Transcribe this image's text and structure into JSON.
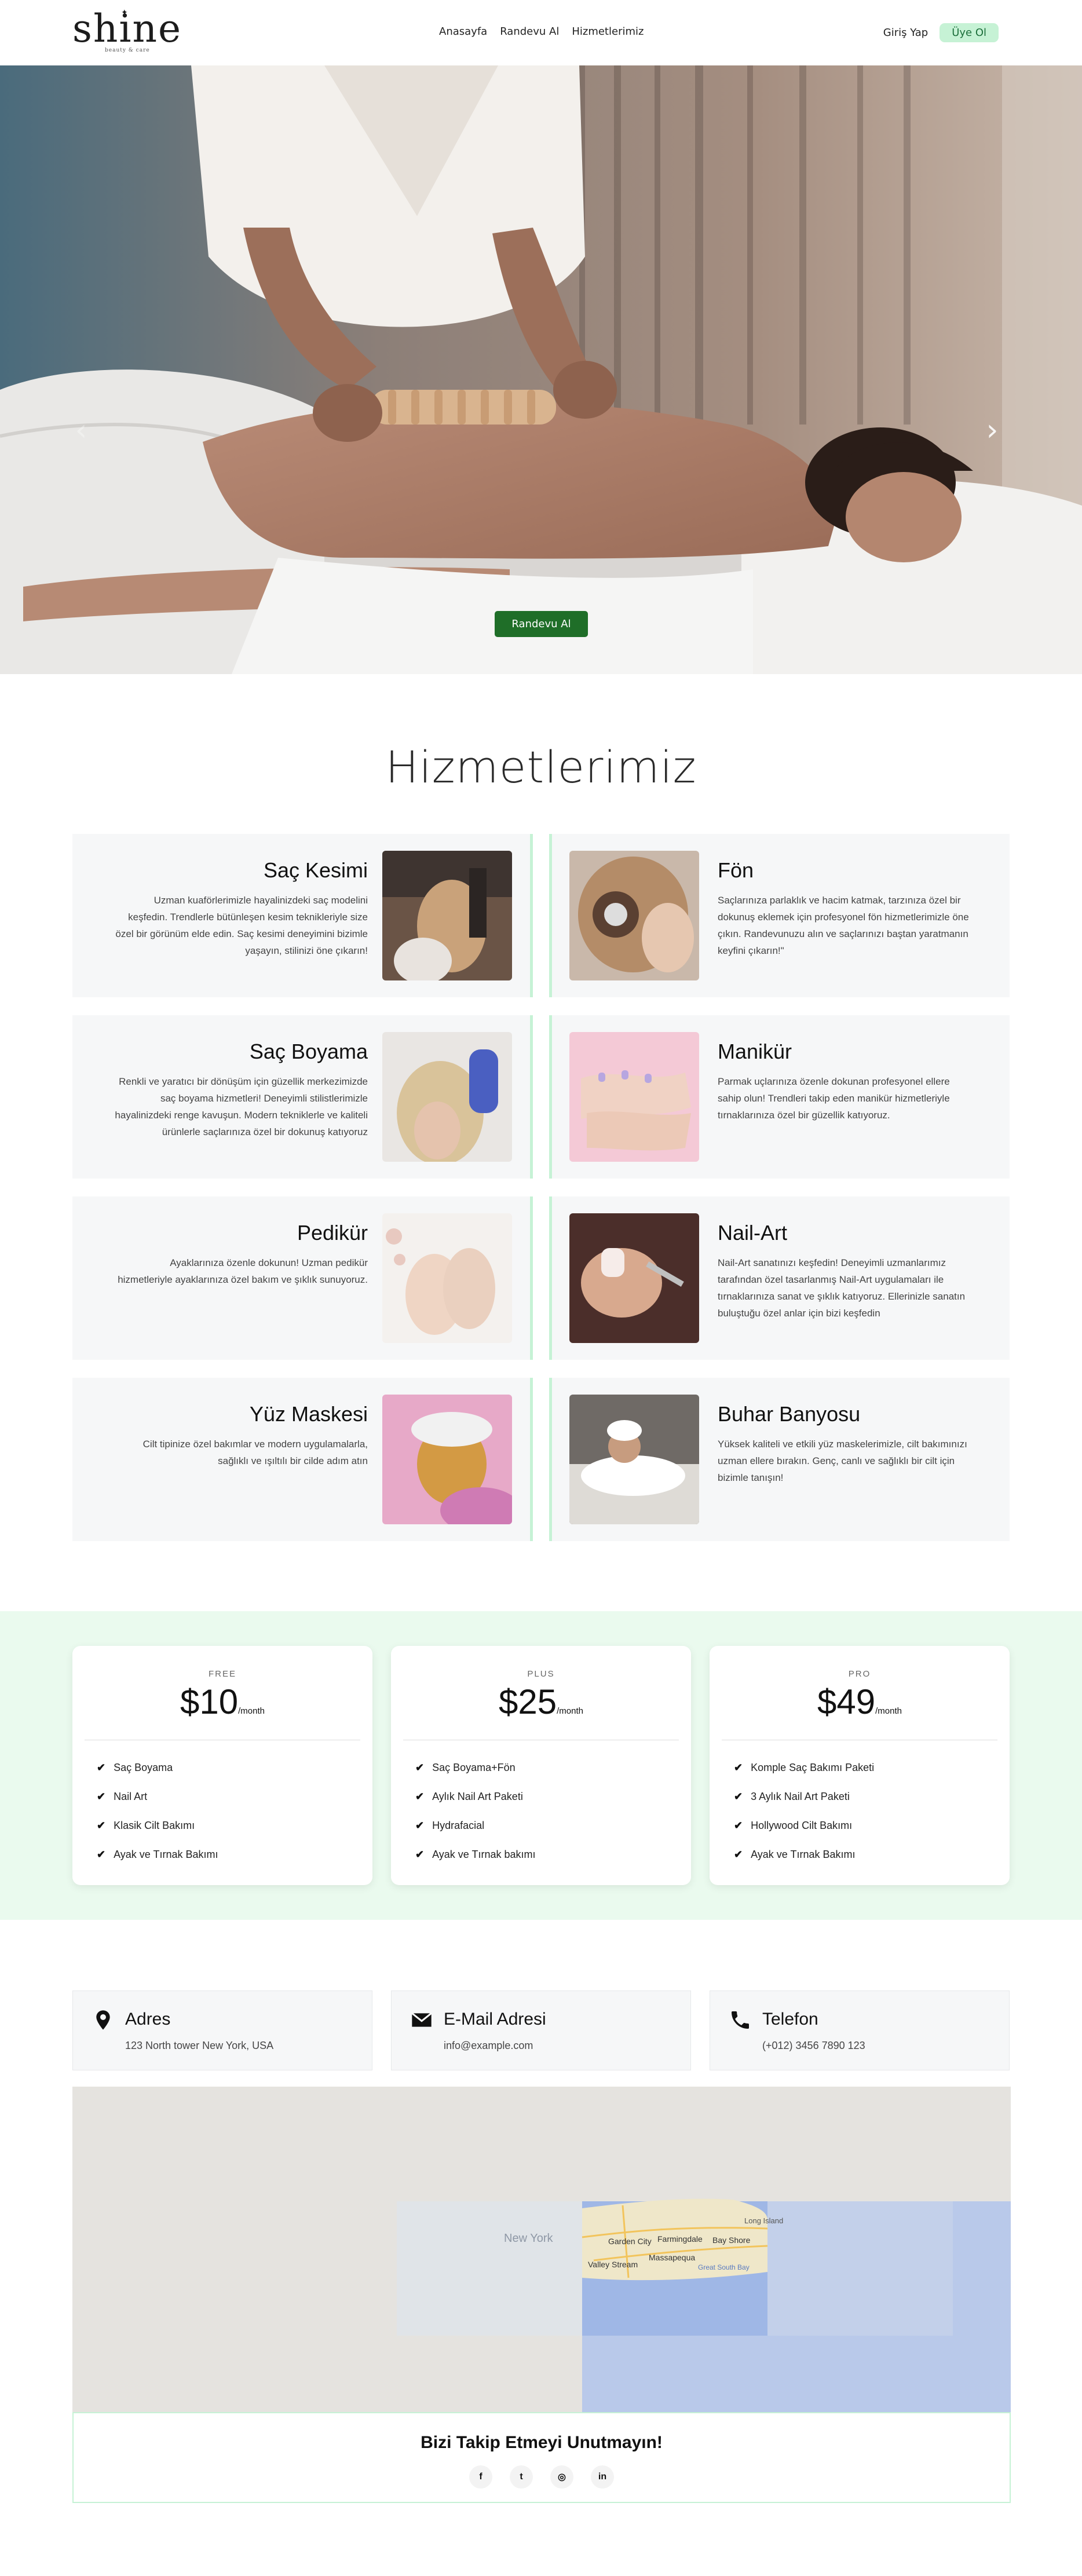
{
  "nav": {
    "logo_text": "shine",
    "logo_tagline": "beauty & care",
    "menu": [
      "Anasayfa",
      "Randevu Al",
      "Hizmetlerimiz"
    ],
    "login": "Giriş Yap",
    "signup": "Üye Ol"
  },
  "hero": {
    "button": "Randevu Al",
    "prev_icon": "chevron-left-icon",
    "next_icon": "chevron-right-icon"
  },
  "services": {
    "title": "Hizmetlerimiz",
    "items": [
      {
        "title": "Saç Kesimi",
        "desc": "Uzman kuaförlerimizle hayalinizdeki saç modelini keşfedin. Trendlerle bütünleşen kesim teknikleriyle size özel bir görünüm elde edin. Saç kesimi deneyimini bizimle yaşayın, stilinizi öne çıkarın!"
      },
      {
        "title": "Fön",
        "desc": "Saçlarınıza parlaklık ve hacim katmak, tarzınıza özel bir dokunuş eklemek için profesyonel fön hizmetlerimizle öne çıkın. Randevunuzu alın ve saçlarınızı baştan yaratmanın keyfini çıkarın!\""
      },
      {
        "title": "Saç Boyama",
        "desc": "Renkli ve yaratıcı bir dönüşüm için güzellik merkezimizde saç boyama hizmetleri! Deneyimli stilistlerimizle hayalinizdeki renge kavuşun. Modern tekniklerle ve kaliteli ürünlerle saçlarınıza özel bir dokunuş katıyoruz"
      },
      {
        "title": "Manikür",
        "desc": "Parmak uçlarınıza özenle dokunan profesyonel ellere sahip olun! Trendleri takip eden manikür hizmetleriyle tırnaklarınıza özel bir güzellik katıyoruz."
      },
      {
        "title": "Pedikür",
        "desc": "Ayaklarınıza özenle dokunun! Uzman pedikür hizmetleriyle ayaklarınıza özel bakım ve şıklık sunuyoruz."
      },
      {
        "title": "Nail-Art",
        "desc": "Nail-Art sanatınızı keşfedin! Deneyimli uzmanlarımız tarafından özel tasarlanmış Nail-Art uygulamaları ile tırnaklarınıza sanat ve şıklık katıyoruz. Ellerinizle sanatın buluştuğu özel anlar için bizi keşfedin"
      },
      {
        "title": "Yüz Maskesi",
        "desc": "Cilt tipinize özel bakımlar ve modern uygulamalarla, sağlıklı ve ışıltılı bir cilde adım atın"
      },
      {
        "title": "Buhar Banyosu",
        "desc": "Yüksek kaliteli ve etkili yüz maskelerimizle, cilt bakımınızı uzman ellere bırakın. Genç, canlı ve sağlıklı bir cilt için bizimle tanışın!"
      }
    ]
  },
  "pricing": {
    "plans": [
      {
        "tier": "FREE",
        "price": "$10",
        "period": "/month",
        "features": [
          "Saç Boyama",
          "Nail Art",
          "Klasik Cilt Bakımı",
          "Ayak ve Tırnak Bakımı"
        ]
      },
      {
        "tier": "PLUS",
        "price": "$25",
        "period": "/month",
        "features": [
          "Saç Boyama+Fön",
          "Aylık Nail Art Paketi",
          "Hydrafacial",
          "Ayak ve Tırnak bakımı"
        ]
      },
      {
        "tier": "PRO",
        "price": "$49",
        "period": "/month",
        "features": [
          "Komple Saç Bakımı Paketi",
          "3 Aylık Nail Art Paketi",
          "Hollywood Cilt Bakımı",
          "Ayak ve Tırnak Bakımı"
        ]
      }
    ]
  },
  "contact": {
    "address": {
      "label": "Adres",
      "value": "123 North tower New York, USA",
      "icon": "map-pin-icon"
    },
    "email": {
      "label": "E-Mail Adresi",
      "value": "info@example.com",
      "icon": "envelope-icon"
    },
    "phone": {
      "label": "Telefon",
      "value": "(+012) 3456 7890 123",
      "icon": "phone-icon"
    }
  },
  "map": {
    "labels": [
      "New York",
      "Garden City",
      "Farmingdale",
      "Bay Shore",
      "Long Island",
      "Valley Stream",
      "Massapequa",
      "Great South Bay"
    ]
  },
  "follow": {
    "title": "Bizi Takip Etmeyi Unutmayın!",
    "socials": [
      {
        "name": "facebook-icon",
        "glyph": "f"
      },
      {
        "name": "twitter-icon",
        "glyph": "t"
      },
      {
        "name": "instagram-icon",
        "glyph": "◎"
      },
      {
        "name": "linkedin-icon",
        "glyph": "in"
      }
    ]
  }
}
